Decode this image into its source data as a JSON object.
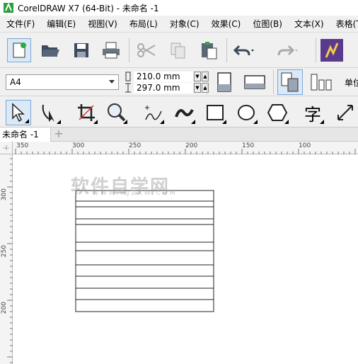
{
  "window": {
    "title": "CorelDRAW X7 (64-Bit) - 未命名 -1",
    "logo_icon": "coreldraw-logo-icon"
  },
  "menubar": {
    "items": [
      {
        "label": "文件(F)"
      },
      {
        "label": "编辑(E)"
      },
      {
        "label": "视图(V)"
      },
      {
        "label": "布局(L)"
      },
      {
        "label": "对象(C)"
      },
      {
        "label": "效果(C)"
      },
      {
        "label": "位图(B)"
      },
      {
        "label": "文本(X)"
      },
      {
        "label": "表格(T"
      }
    ]
  },
  "toolbar": {
    "buttons": [
      "new-document-icon",
      "open-folder-icon",
      "save-icon",
      "print-icon",
      "cut-icon",
      "copy-icon",
      "paste-icon",
      "undo-icon",
      "redo-icon",
      "corel-connect-icon"
    ]
  },
  "property_bar": {
    "page_size": "A4",
    "width": "210.0 mm",
    "height": "297.0 mm",
    "units_label": "单位"
  },
  "toolbox": {
    "tools": [
      "pick-tool-icon",
      "shape-tool-icon",
      "crop-tool-icon",
      "zoom-tool-icon",
      "freehand-tool-icon",
      "artistic-media-icon",
      "rectangle-tool-icon",
      "ellipse-tool-icon",
      "polygon-tool-icon",
      "text-tool-icon",
      "dimension-tool-icon"
    ],
    "text_glyph": "字"
  },
  "tabs": {
    "active": "未命名 -1",
    "add_symbol": "+"
  },
  "ruler": {
    "top_labels": [
      "350",
      "300",
      "250",
      "200",
      "150",
      "100"
    ],
    "left_labels": [
      "300",
      "250",
      "200"
    ]
  },
  "watermark": {
    "main": "软件自学网",
    "sub": "WWW.RJZXW.COM"
  },
  "table": {
    "rows": 11
  }
}
